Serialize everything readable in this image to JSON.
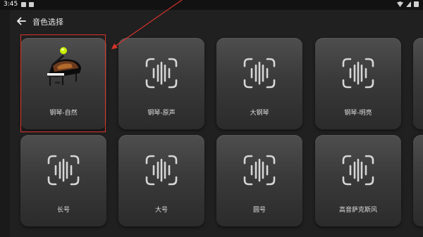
{
  "status_bar": {
    "time": "3:45"
  },
  "header": {
    "title": "音色选择"
  },
  "instruments": [
    {
      "label": "钢琴-自然",
      "icon": "piano-image",
      "selected": true
    },
    {
      "label": "钢琴-原声",
      "icon": "waveform-icon"
    },
    {
      "label": "大钢琴",
      "icon": "waveform-icon"
    },
    {
      "label": "钢琴-明亮",
      "icon": "waveform-icon"
    },
    {
      "label": "长号",
      "icon": "waveform-icon"
    },
    {
      "label": "大号",
      "icon": "waveform-icon"
    },
    {
      "label": "圆号",
      "icon": "waveform-icon"
    },
    {
      "label": "高音萨克斯风",
      "icon": "waveform-icon"
    }
  ],
  "colors": {
    "highlight": "#d9342b",
    "indicator": "#c8f000"
  }
}
